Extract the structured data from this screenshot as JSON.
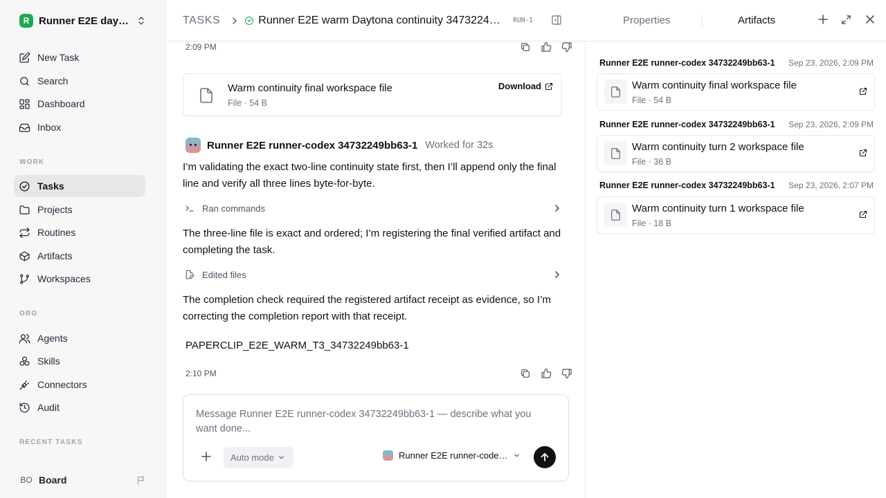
{
  "workspace": {
    "initial": "R",
    "name": "Runner E2E dayt..."
  },
  "nav_primary": [
    {
      "key": "new-task",
      "label": "New Task",
      "icon": "pencil-square-icon"
    },
    {
      "key": "search",
      "label": "Search",
      "icon": "search-icon"
    },
    {
      "key": "dashboard",
      "label": "Dashboard",
      "icon": "grid-icon"
    },
    {
      "key": "inbox",
      "label": "Inbox",
      "icon": "inbox-icon"
    }
  ],
  "sections": {
    "work": "WORK",
    "org": "ORG",
    "recent": "RECENT TASKS"
  },
  "nav_work": [
    {
      "key": "tasks",
      "label": "Tasks",
      "icon": "check-circle-icon",
      "active": true
    },
    {
      "key": "projects",
      "label": "Projects",
      "icon": "folder-icon"
    },
    {
      "key": "routines",
      "label": "Routines",
      "icon": "repeat-icon"
    },
    {
      "key": "artifacts",
      "label": "Artifacts",
      "icon": "box-icon"
    },
    {
      "key": "workspaces",
      "label": "Workspaces",
      "icon": "git-branch-icon"
    }
  ],
  "nav_org": [
    {
      "key": "agents",
      "label": "Agents",
      "icon": "users-icon"
    },
    {
      "key": "skills",
      "label": "Skills",
      "icon": "skills-icon"
    },
    {
      "key": "connectors",
      "label": "Connectors",
      "icon": "plug-icon"
    },
    {
      "key": "audit",
      "label": "Audit",
      "icon": "history-icon"
    }
  ],
  "board": {
    "initials": "BO",
    "label": "Board"
  },
  "header": {
    "root": "TASKS",
    "title": "Runner E2E warm Daytona continuity 34732249bb6...",
    "id": "RUN-1"
  },
  "thread": {
    "ts_top": "2:09 PM",
    "file": {
      "name": "Warm continuity final workspace file",
      "meta": "File · 54 B",
      "download": "Download"
    },
    "agent": "Runner E2E runner-codex 34732249bb63-1",
    "worked": "Worked for 32s",
    "para1": "I’m validating the exact two-line continuity state first, then I’ll append only the final line and verify all three lines byte-for-byte.",
    "tool1": "Ran commands",
    "para2": "The three-line file is exact and ordered; I’m registering the final verified artifact and completing the task.",
    "tool2": "Edited files",
    "para3": "The completion check required the registered artifact receipt as evidence, so I’m correcting the completion report with that receipt.",
    "receipt": "PAPERCLIP_E2E_WARM_T3_34732249bb63-1",
    "ts_bottom": "2:10 PM"
  },
  "composer": {
    "placeholder": "Message Runner E2E runner-codex 34732249bb63-1 — describe what you want done...",
    "mode": "Auto mode",
    "agent": "Runner E2E runner-codex..."
  },
  "right_panel": {
    "tab_properties": "Properties",
    "tab_artifacts": "Artifacts",
    "artifacts": [
      {
        "owner": "Runner E2E runner-codex 34732249bb63-1",
        "when": "Sep 23, 2026, 2:09 PM",
        "name": "Warm continuity final workspace file",
        "meta": "File · 54 B"
      },
      {
        "owner": "Runner E2E runner-codex 34732249bb63-1",
        "when": "Sep 23, 2026, 2:09 PM",
        "name": "Warm continuity turn 2 workspace file",
        "meta": "File · 36 B"
      },
      {
        "owner": "Runner E2E runner-codex 34732249bb63-1",
        "when": "Sep 23, 2026, 2:07 PM",
        "name": "Warm continuity turn 1 workspace file",
        "meta": "File · 18 B"
      }
    ]
  },
  "colors": {
    "accent_green": "#1faa4f",
    "status_green": "#22a35a",
    "send_button": "#111111",
    "active_nav": "#e7e7ea"
  }
}
